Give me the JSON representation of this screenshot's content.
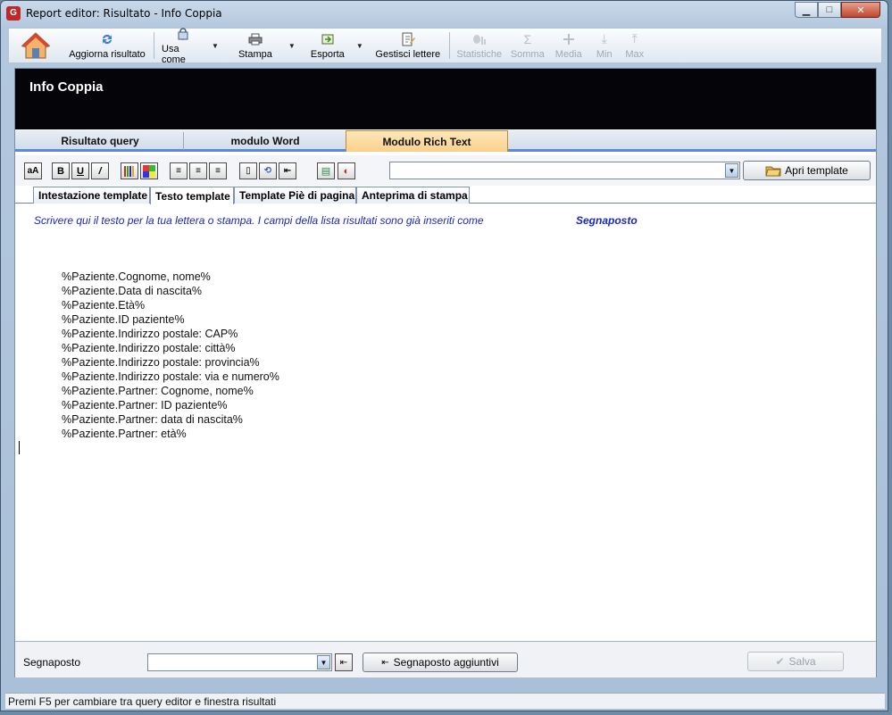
{
  "window": {
    "title": "Report editor: Risultato - Info Coppia",
    "app_icon": "G"
  },
  "toolbar": {
    "refresh": "Aggiorna risultato",
    "use_as": "Usa come",
    "print": "Stampa",
    "export": "Esporta",
    "manage_letters": "Gestisci lettere",
    "statistics": "Statistiche",
    "sum": "Somma",
    "mean": "Media",
    "min": "Min",
    "max": "Max"
  },
  "header": {
    "title": "Info Coppia"
  },
  "main_tabs": [
    "Risultato query",
    "modulo Word",
    "Modulo Rich Text"
  ],
  "format_bar": {
    "open_template": "Apri template",
    "combo_value": ""
  },
  "sub_tabs": [
    "Intestazione template",
    "Testo template",
    "Template Piè di pagina",
    "Anteprima di stampa"
  ],
  "editor": {
    "instruction": "Scrivere qui il testo per la tua lettera o stampa. I campi della lista risultati sono già inseriti come",
    "instruction_strong": "Segnaposto",
    "lines": [
      "%Paziente.Cognome, nome%",
      "%Paziente.Data di nascita%",
      "%Paziente.Età%",
      "%Paziente.ID paziente%",
      "%Paziente.Indirizzo postale: CAP%",
      "%Paziente.Indirizzo postale: città%",
      "%Paziente.Indirizzo postale: provincia%",
      "%Paziente.Indirizzo postale: via e numero%",
      "%Paziente.Partner: Cognome, nome%",
      "%Paziente.Partner: ID paziente%",
      "%Paziente.Partner: data di nascita%",
      "%Paziente.Partner: età%"
    ]
  },
  "bottom": {
    "label": "Segnaposto",
    "extra_button": "Segnaposto aggiuntivi",
    "save": "Salva"
  },
  "status": "Premi F5 per cambiare tra query editor e finestra risultati",
  "colors": {
    "accent_tab": "#fcd08b",
    "header_band": "#050509",
    "instruction_text": "#1a28c6"
  }
}
